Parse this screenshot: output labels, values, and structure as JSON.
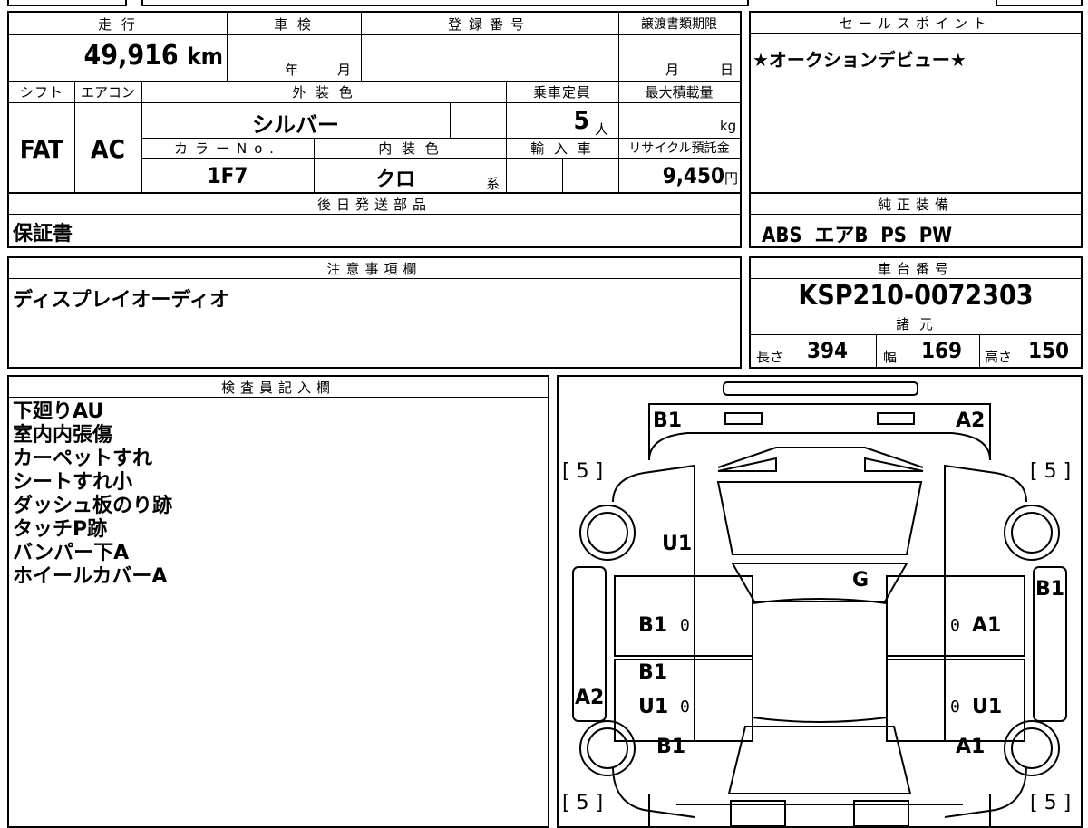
{
  "vehicle": {
    "mileage_label": "走 行",
    "mileage": "49,916",
    "mileage_unit": "km",
    "inspection_label": "車 検",
    "inspection_year": "年",
    "inspection_month": "月",
    "reg_no_label": "登録番号",
    "deadline_label": "譲渡書類期限",
    "deadline_month": "月",
    "deadline_day": "日",
    "shift_label": "シフト",
    "shift": "FAT",
    "ac_label": "エアコン",
    "ac": "AC",
    "exterior_label": "外 装 色",
    "exterior_color": "シルバー",
    "color_no_label": "カラーNo.",
    "color_no": "1F7",
    "interior_label": "内 装 色",
    "interior_color": "クロ",
    "interior_suffix": "系",
    "capacity_label": "乗車定員",
    "capacity": "5",
    "capacity_unit": "人",
    "maxload_label": "最大積載量",
    "maxload_unit": "kg",
    "import_label": "輸 入 車",
    "recycle_label": "リサイクル預託金",
    "recycle_fee": "9,450",
    "recycle_unit": "円"
  },
  "sales_point": {
    "label": "セールスポイント",
    "text": "★オークションデビュー★"
  },
  "later_parts": {
    "label": "後日発送部品",
    "text": "保証書"
  },
  "equipment": {
    "label": "純正装備",
    "text": "ABS  エアB  PS  PW"
  },
  "notes": {
    "label": "注意事項欄",
    "text": "ディスプレイオーディオ"
  },
  "chassis": {
    "label": "車台番号",
    "number": "KSP210-0072303",
    "specs_label": "諸 元",
    "length_label": "長さ",
    "length": "394",
    "width_label": "幅",
    "width": "169",
    "height_label": "高さ",
    "height": "150"
  },
  "inspector": {
    "label": "検査員記入欄",
    "lines": [
      "下廻りAU",
      "室内内張傷",
      "カーペットすれ",
      "シートすれ小",
      "ダッシュ板のり跡",
      "タッチP跡",
      "バンパー下A",
      "ホイールカバーA"
    ]
  },
  "diagram": {
    "tire_fl": "[ 5 ]",
    "tire_fr": "[ 5 ]",
    "tire_rl": "[ 5 ]",
    "tire_rr": "[ 5 ]",
    "marks": {
      "front_left": "B1",
      "front_right": "A2",
      "hood_left": "U1",
      "windshield": "G",
      "fender_right": "B1",
      "door_fl": "B1",
      "door_fr": "A1",
      "door_rl_top": "B1",
      "door_rl": "U1",
      "door_rr": "U1",
      "side_left": "A2",
      "rear_left": "B1",
      "rear_right": "A1",
      "zero_fl": "0",
      "zero_fr": "0",
      "zero_rl": "0",
      "zero_rr": "0"
    }
  }
}
